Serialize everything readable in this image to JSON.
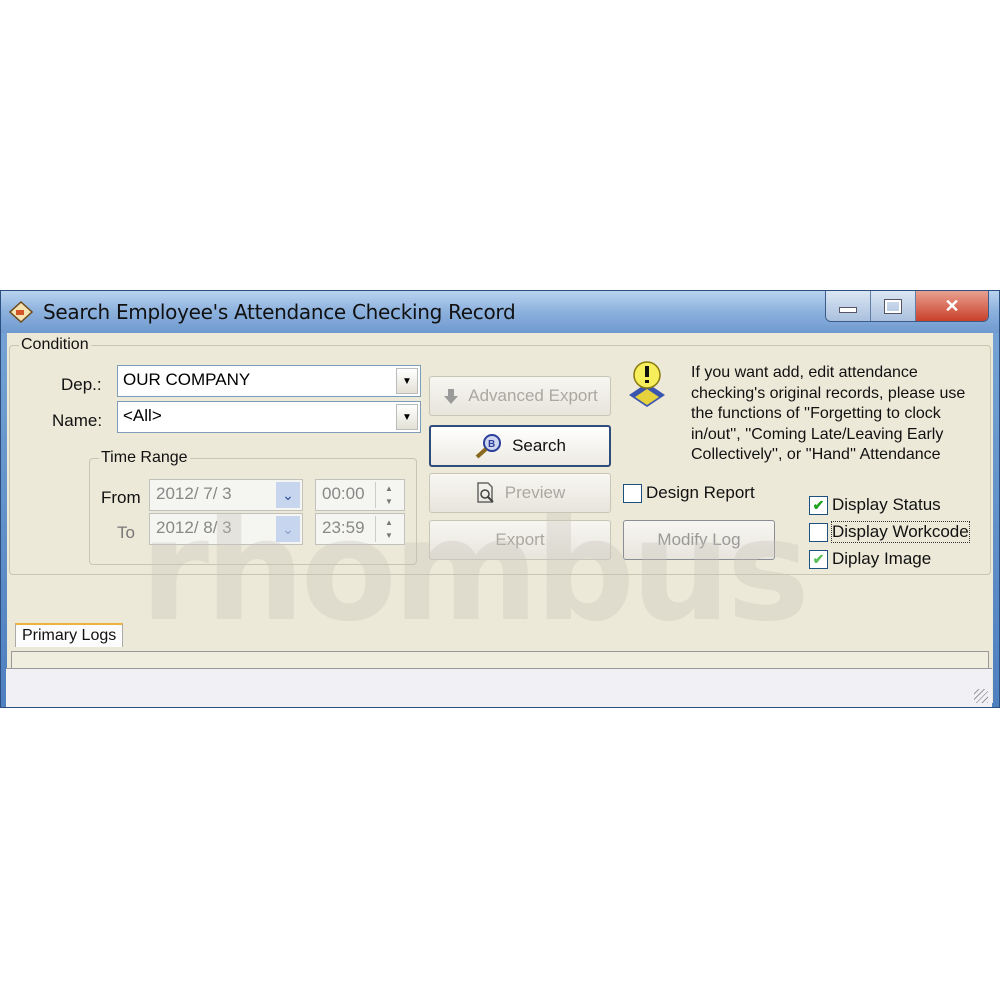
{
  "window": {
    "title": "Search Employee's Attendance Checking Record",
    "controls": {
      "minimize": "minimize-icon",
      "maximize": "maximize-icon",
      "close": "close-icon"
    }
  },
  "condition": {
    "group_label": "Condition",
    "dep_label": "Dep.:",
    "dep_value": "OUR COMPANY",
    "name_label": "Name:",
    "name_value": "<All>",
    "time_range": {
      "label": "Time Range",
      "from_label": "From",
      "from_date": "2012/ 7/ 3",
      "from_time": "00:00",
      "to_label": "To",
      "to_date": "2012/ 8/ 3",
      "to_time": "23:59"
    }
  },
  "buttons": {
    "advanced_export": "Advanced Export",
    "search": "Search",
    "preview": "Preview",
    "export": "Export",
    "modify_log": "Modify Log"
  },
  "info_text": "If you want add, edit attendance checking's original records, please use the functions of ''Forgetting to clock in/out'', ''Coming Late/Leaving Early Collectively'', or ''Hand'' Attendance Checking",
  "checkboxes": [
    {
      "label": "Design Report",
      "checked": false
    },
    {
      "label": "Display Status",
      "checked": true
    },
    {
      "label": "Display Workcode",
      "checked": false
    },
    {
      "label": "Diplay Image",
      "checked": true
    }
  ],
  "tabs": [
    {
      "label": "Primary Logs",
      "active": true
    }
  ],
  "watermark": "rhombus"
}
